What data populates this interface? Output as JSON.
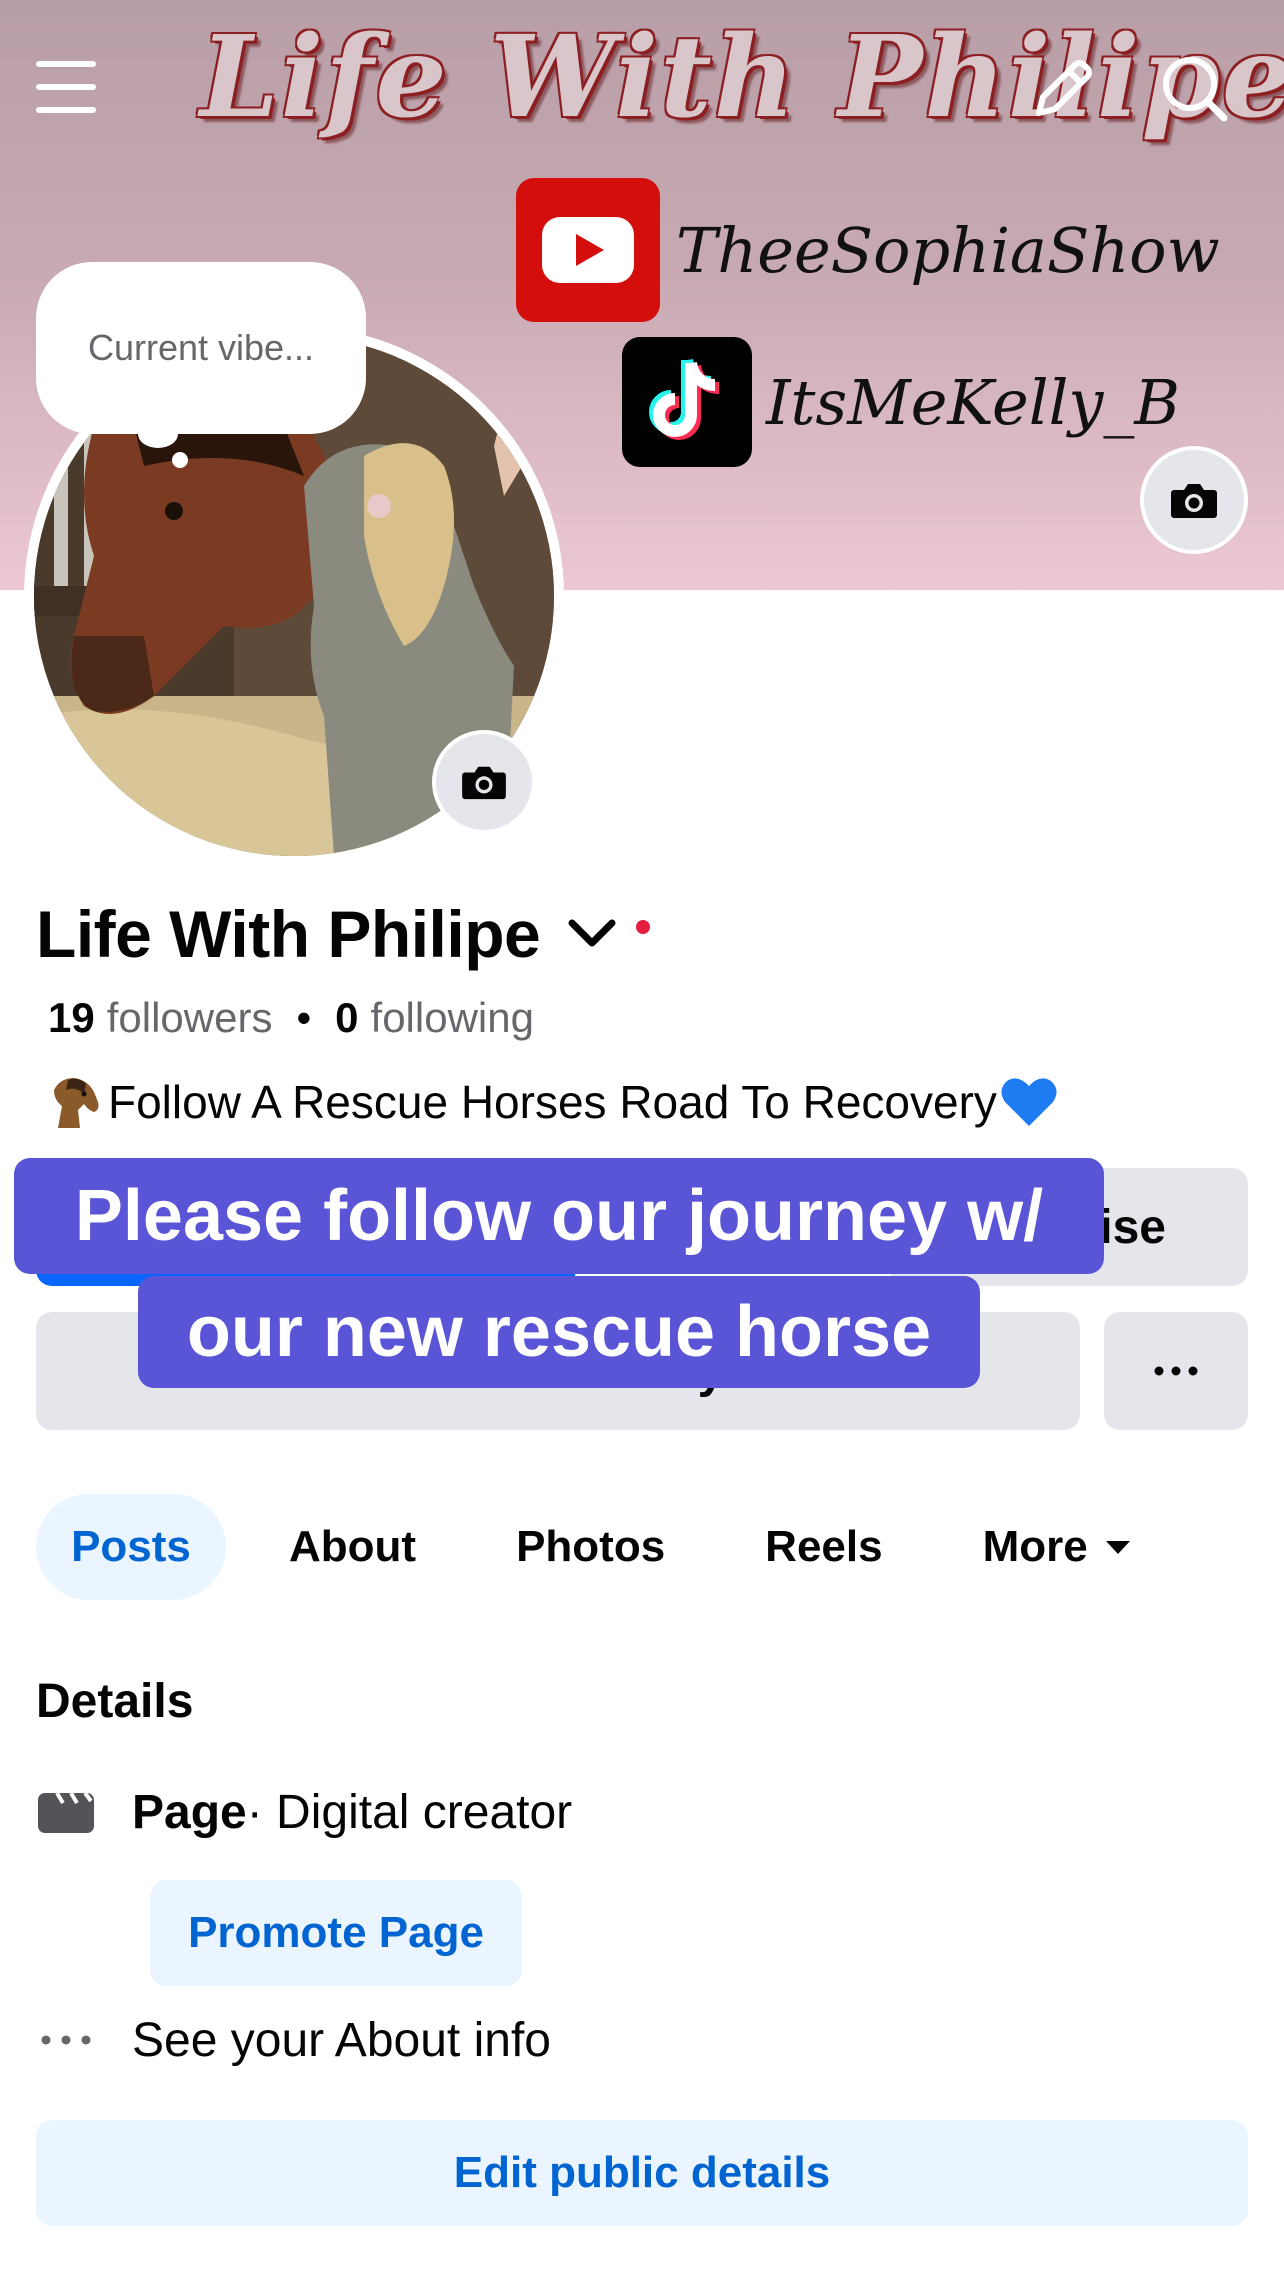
{
  "cover": {
    "title": "Life With Philipe",
    "youtube_handle": "TheeSophiaShow",
    "tiktok_handle": "ItsMeKelly_B",
    "icons": {
      "menu": "menu-icon",
      "edit": "pencil-icon",
      "search": "search-icon",
      "camera": "camera-icon"
    }
  },
  "profile": {
    "vibe_placeholder": "Current vibe...",
    "name": "Life With Philipe",
    "followers_count": "19",
    "followers_label": "followers",
    "separator": "•",
    "following_count": "0",
    "following_label": "following",
    "bio": "Follow A Rescue Horses Road To Recovery"
  },
  "actions": {
    "advertise_label_visible": "ise",
    "add_to_story_label": "Add to story",
    "add_to_story_icon": "+",
    "more_label": "..."
  },
  "caption": {
    "line1": "Please follow our journey w/",
    "line2": "our new rescue horse"
  },
  "tabs": [
    {
      "label": "Posts",
      "active": true
    },
    {
      "label": "About",
      "active": false
    },
    {
      "label": "Photos",
      "active": false
    },
    {
      "label": "Reels",
      "active": false
    },
    {
      "label": "More",
      "active": false
    }
  ],
  "details": {
    "title": "Details",
    "page_label": "Page",
    "page_category": " · Digital creator",
    "promote_label": "Promote Page",
    "about_label": "See your About info",
    "edit_label": "Edit public details"
  },
  "colors": {
    "accent_blue": "#0866ff",
    "link_blue": "#0064d1",
    "caption_bg": "#5a55d6",
    "tab_active_bg": "#ebf5ff",
    "button_gray": "#e4e6eb",
    "notification_red": "#e41e3f"
  }
}
